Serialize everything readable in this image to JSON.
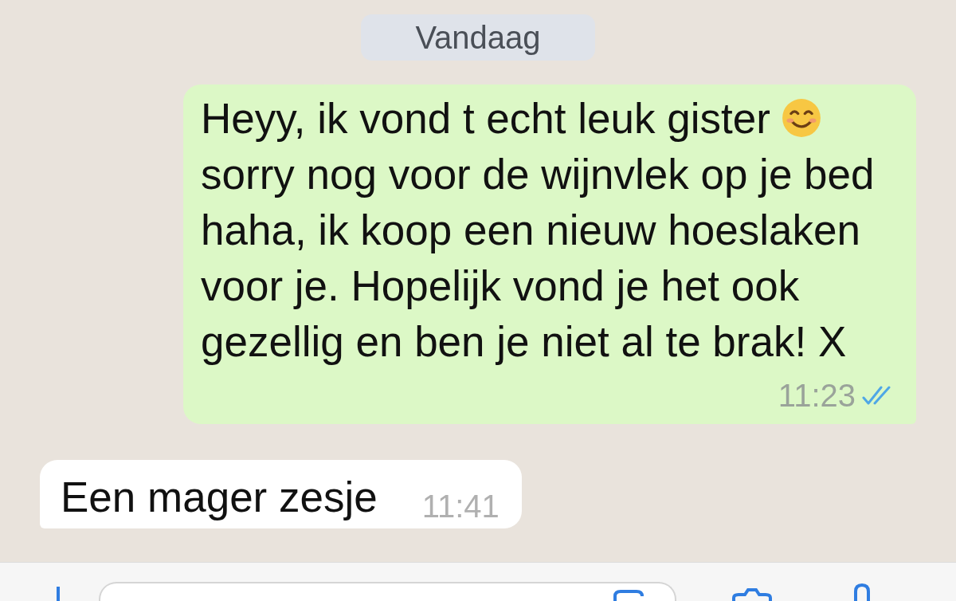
{
  "date_divider": "Vandaag",
  "messages": [
    {
      "kind": "outgoing",
      "parts": [
        "Heyy, ik vond t echt leuk gister",
        "sorry nog voor de wijnvlek op je bed haha, ik koop een nieuw hoeslaken voor je. Hopelijk vond je het ook gezellig en ben je niet al te brak! X"
      ],
      "time": "11:23",
      "read": true
    },
    {
      "kind": "incoming",
      "parts": [
        "Een mager zesje"
      ],
      "time": "11:41"
    }
  ]
}
